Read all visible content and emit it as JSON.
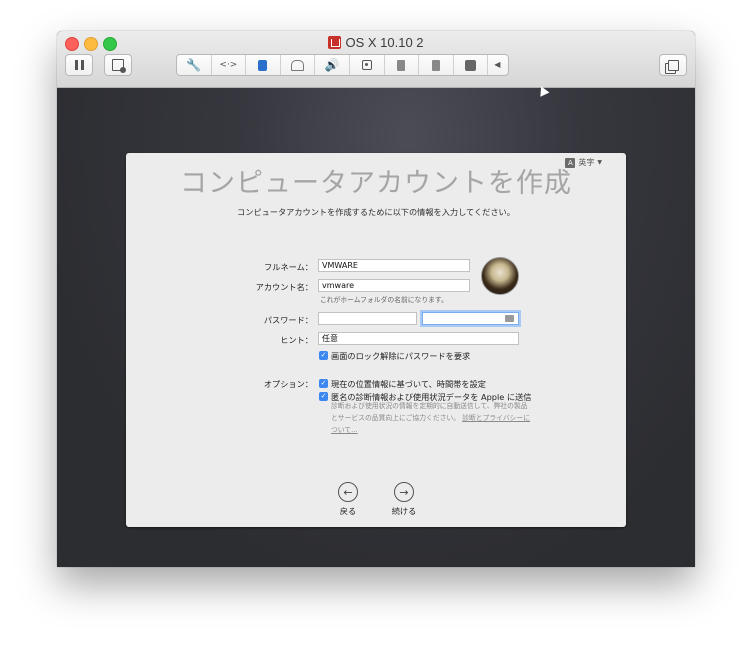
{
  "window": {
    "title": "OS X 10.10 2"
  },
  "toolbar": {
    "pause_icon": "pause-icon",
    "snapshot_icon": "snapshot-icon",
    "device_icons": [
      "wrench-icon",
      "network-arrows-icon",
      "hard-disk-icon",
      "optical-drive-icon",
      "speaker-icon",
      "camera-icon",
      "usb-icon",
      "usb-icon",
      "sharing-icon",
      "collapse-arrow-icon"
    ],
    "fullscreen_icon": "fullscreen-icon"
  },
  "setup": {
    "language_label": "英字",
    "title": "コンピュータアカウントを作成",
    "subtitle": "コンピュータアカウントを作成するために以下の情報を入力してください。",
    "fullname_label": "フルネーム：",
    "fullname_value": "VMWARE",
    "account_label": "アカウント名：",
    "account_value": "vmware",
    "account_hint": "これがホームフォルダの名前になります。",
    "password_label": "パスワード：",
    "hint_label": "ヒント：",
    "hint_placeholder": "任意",
    "lock_checkbox": "画面のロック解除にパスワードを要求",
    "options_label": "オプション：",
    "option_timezone": "現在の位置情報に基づいて、時間帯を設定",
    "option_diagnostics": "匿名の診断情報および使用状況データを Apple に送信",
    "privacy_text": "診断および使用状況の情報を定期的に自動送信して、弊社の製品とサービスの品質向上にご協力ください。",
    "privacy_link": "診断とプライバシーについて...",
    "back_label": "戻る",
    "continue_label": "続ける"
  },
  "colors": {
    "accent": "#3d88f0",
    "window_bg": "#2c2d31",
    "panel_bg": "#ececec"
  }
}
